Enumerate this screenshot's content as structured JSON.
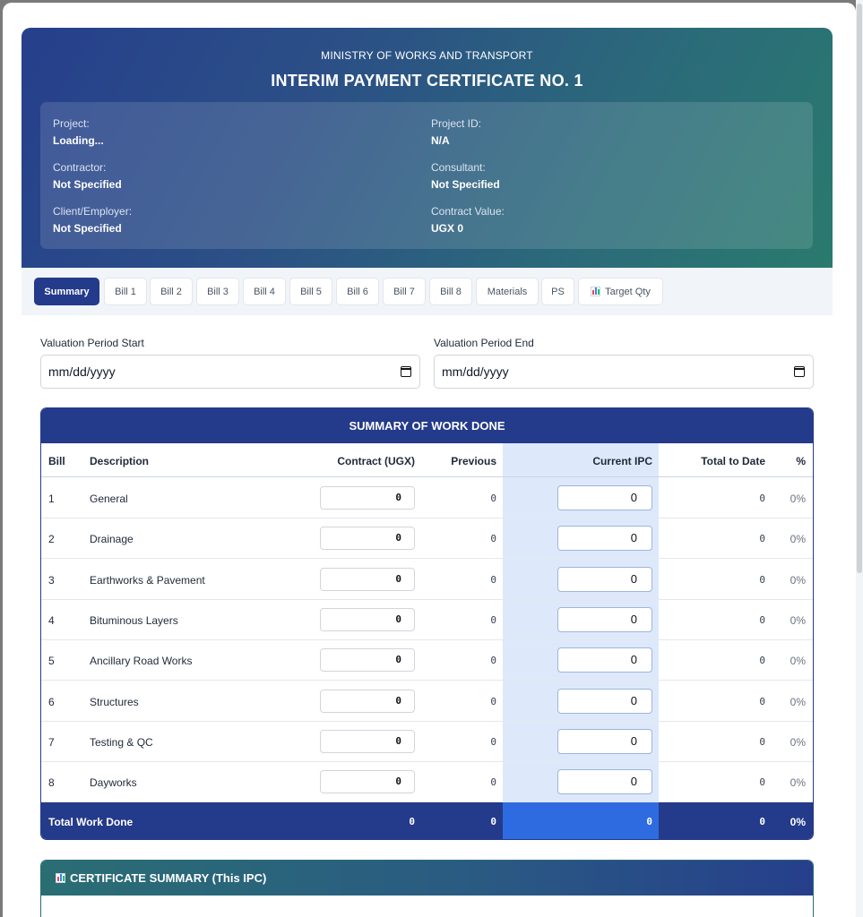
{
  "header": {
    "ministry": "MINISTRY OF WORKS AND TRANSPORT",
    "title": "INTERIM PAYMENT CERTIFICATE NO. 1",
    "info": {
      "project_label": "Project:",
      "project_value": "Loading...",
      "project_id_label": "Project ID:",
      "project_id_value": "N/A",
      "contractor_label": "Contractor:",
      "contractor_value": "Not Specified",
      "consultant_label": "Consultant:",
      "consultant_value": "Not Specified",
      "client_label": "Client/Employer:",
      "client_value": "Not Specified",
      "contract_value_label": "Contract Value:",
      "contract_value_value": "UGX 0"
    }
  },
  "tabs": [
    "Summary",
    "Bill 1",
    "Bill 2",
    "Bill 3",
    "Bill 4",
    "Bill 5",
    "Bill 6",
    "Bill 7",
    "Bill 8",
    "Materials",
    "PS",
    "Target Qty"
  ],
  "valuation": {
    "start_label": "Valuation Period Start",
    "start_value": "mm/dd/yyyy",
    "end_label": "Valuation Period End",
    "end_value": "mm/dd/yyyy"
  },
  "summary": {
    "title": "SUMMARY OF WORK DONE",
    "columns": [
      "Bill",
      "Description",
      "Contract (UGX)",
      "Previous",
      "Current IPC",
      "Total to Date",
      "%"
    ],
    "rows": [
      {
        "bill": "1",
        "description": "General",
        "contract": "0",
        "previous": "0",
        "current": "0",
        "total": "0",
        "pct": "0%"
      },
      {
        "bill": "2",
        "description": "Drainage",
        "contract": "0",
        "previous": "0",
        "current": "0",
        "total": "0",
        "pct": "0%"
      },
      {
        "bill": "3",
        "description": "Earthworks & Pavement",
        "contract": "0",
        "previous": "0",
        "current": "0",
        "total": "0",
        "pct": "0%"
      },
      {
        "bill": "4",
        "description": "Bituminous Layers",
        "contract": "0",
        "previous": "0",
        "current": "0",
        "total": "0",
        "pct": "0%"
      },
      {
        "bill": "5",
        "description": "Ancillary Road Works",
        "contract": "0",
        "previous": "0",
        "current": "0",
        "total": "0",
        "pct": "0%"
      },
      {
        "bill": "6",
        "description": "Structures",
        "contract": "0",
        "previous": "0",
        "current": "0",
        "total": "0",
        "pct": "0%"
      },
      {
        "bill": "7",
        "description": "Testing & QC",
        "contract": "0",
        "previous": "0",
        "current": "0",
        "total": "0",
        "pct": "0%"
      },
      {
        "bill": "8",
        "description": "Dayworks",
        "contract": "0",
        "previous": "0",
        "current": "0",
        "total": "0",
        "pct": "0%"
      }
    ],
    "total": {
      "label": "Total Work Done",
      "contract": "0",
      "previous": "0",
      "current": "0",
      "total": "0",
      "pct": "0%"
    }
  },
  "certificate": {
    "title": "CERTIFICATE SUMMARY (This IPC)"
  },
  "icons": {
    "chart": "bar-chart-icon",
    "calendar": "calendar-icon"
  },
  "colors": {
    "primary": "#243a8a",
    "teal": "#2a7a6e",
    "current_highlight": "#dde9fb",
    "current_total": "#2f6be0"
  }
}
